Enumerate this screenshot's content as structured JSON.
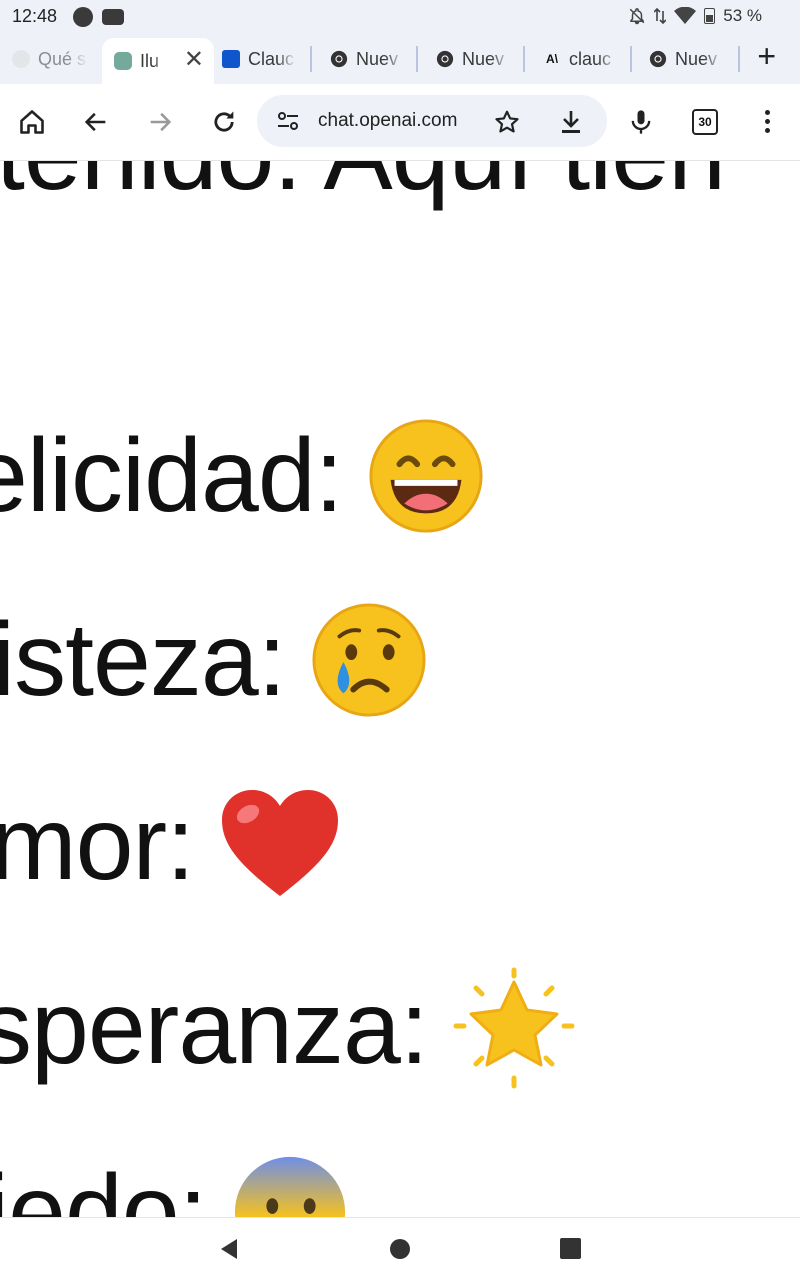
{
  "status_bar": {
    "time": "12:48",
    "battery_text": "53 %",
    "icons": [
      "whatsapp-icon",
      "youtube-icon",
      "bell-off-icon",
      "data-arrows-icon",
      "wifi-icon",
      "battery-icon"
    ]
  },
  "tabs": [
    {
      "title": "Qué s",
      "favicon": "google-icon"
    },
    {
      "title": "Ilu",
      "favicon": "openai-icon",
      "active": true
    },
    {
      "title": "Clauc",
      "favicon": "claude-blue-icon"
    },
    {
      "title": "Nuev",
      "favicon": "chrome-icon"
    },
    {
      "title": "Nuev",
      "favicon": "chrome-icon"
    },
    {
      "title": "clauc",
      "favicon": "anthropic-icon"
    },
    {
      "title": "Nuev",
      "favicon": "chrome-icon"
    }
  ],
  "toolbar": {
    "url": "chat.openai.com",
    "tab_count": "30"
  },
  "content": {
    "lines": [
      "tenido: Aquí tien",
      "elicidad:",
      "isteza:",
      "mor:",
      "speranza:",
      "iedo:"
    ]
  },
  "colors": {
    "chrome_bg": "#eef1f8",
    "emoji_yellow": "#f7c21d",
    "heart_red": "#e0322b"
  }
}
